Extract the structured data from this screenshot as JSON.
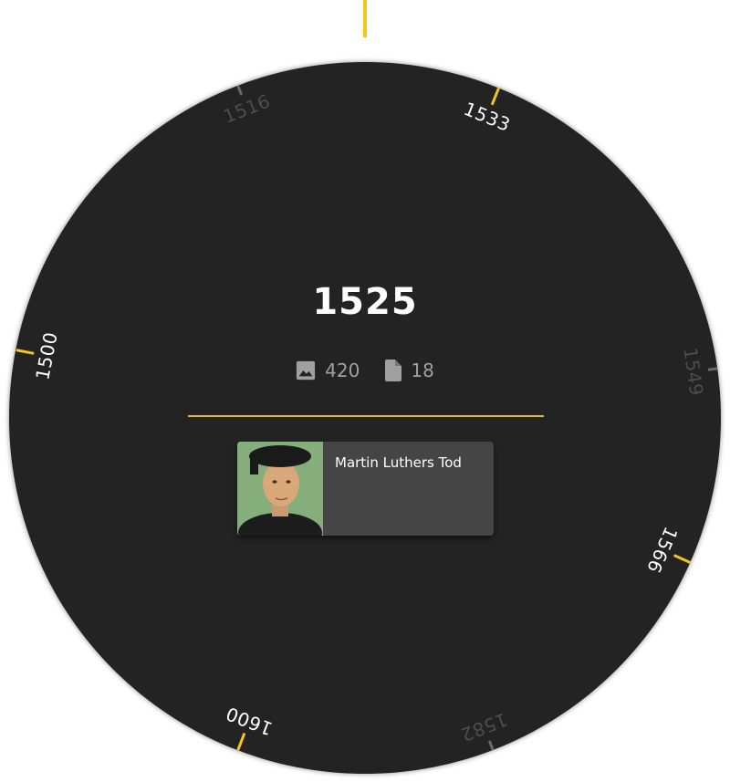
{
  "timeline": {
    "selected_year": "1525",
    "pointer_color": "#f5c518",
    "ticks": [
      {
        "label": "1500",
        "angle": -79,
        "major": true
      },
      {
        "label": "1516",
        "angle": -21,
        "major": false
      },
      {
        "label": "1533",
        "angle": 22,
        "major": true
      },
      {
        "label": "1549",
        "angle": 82,
        "major": false
      },
      {
        "label": "1566",
        "angle": 114,
        "major": true
      },
      {
        "label": "1582",
        "angle": 159,
        "major": false
      },
      {
        "label": "1600",
        "angle": 201,
        "major": true
      }
    ]
  },
  "stats": {
    "images_icon": "image-icon",
    "images_count": "420",
    "documents_icon": "document-icon",
    "documents_count": "18"
  },
  "event_card": {
    "title": "Martin Luthers Tod",
    "thumbnail": "portrait-thumbnail"
  },
  "colors": {
    "accent": "#f5c518",
    "dial_background": "#232323",
    "card_background": "#454545"
  }
}
